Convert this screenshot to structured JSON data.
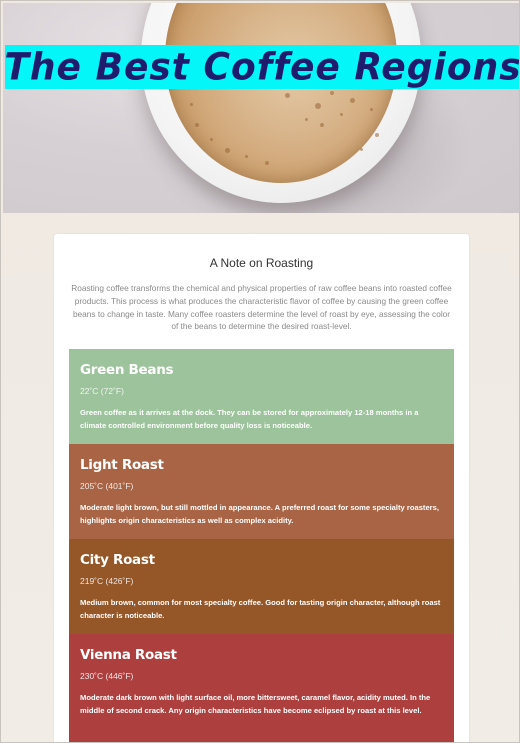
{
  "hero": {
    "title": "The Best Coffee Regions"
  },
  "note": {
    "heading": "A Note on Roasting",
    "intro": "Roasting coffee transforms the chemical and physical properties of raw coffee beans into roasted coffee products. This process is what produces the characteristic flavor of coffee by causing the green coffee beans to change in taste. Many coffee roasters determine the level of roast by eye, assessing the color of the beans to determine the desired roast-level."
  },
  "roasts": [
    {
      "name": "Green Beans",
      "temp": "22˚C (72˚F)",
      "description": "Green coffee as it arrives at the dock. They can be stored for approximately 12-18 months in a climate controlled environment before quality loss is noticeable.",
      "color": "#9cc39b"
    },
    {
      "name": "Light Roast",
      "temp": "205˚C (401˚F)",
      "description": "Moderate light brown, but still mottled in appearance. A preferred roast for some specialty roasters, highlights origin characteristics as well as complex acidity.",
      "color": "#a86445"
    },
    {
      "name": "City Roast",
      "temp": "219˚C (426˚F)",
      "description": "Medium brown, common for most specialty coffee. Good for tasting origin character, although roast character is noticeable.",
      "color": "#955628"
    },
    {
      "name": "Vienna Roast",
      "temp": "230˚C (446˚F)",
      "description": "Moderate dark brown with light surface oil, more bittersweet, caramel flavor, acidity muted. In the middle of second crack. Any origin characteristics have become eclipsed by roast at this level.",
      "color": "#ad3f3f"
    }
  ]
}
